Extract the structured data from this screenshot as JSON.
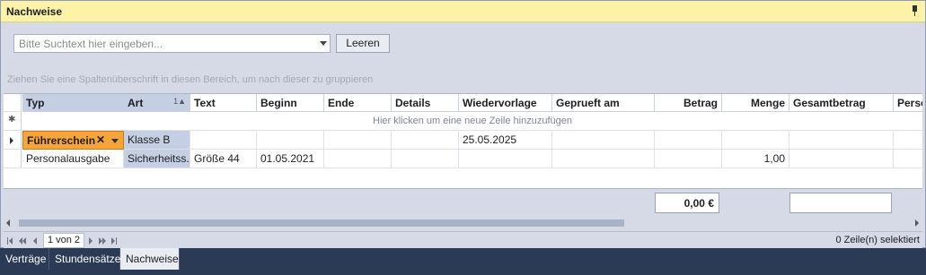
{
  "panel": {
    "title": "Nachweise"
  },
  "search": {
    "placeholder": "Bitte Suchtext hier eingeben...",
    "clear_label": "Leeren"
  },
  "grid": {
    "group_hint": "Ziehen Sie eine Spaltenüberschrift in diesen Bereich, um nach dieser zu gruppieren",
    "columns": [
      "Typ",
      "Art",
      "Text",
      "Beginn",
      "Ende",
      "Details",
      "Wiedervorlage",
      "Geprueft am",
      "Betrag",
      "Menge",
      "Gesamtbetrag",
      "Perso"
    ],
    "sort_indicator": "1▲",
    "new_row_text": "Hier klicken um eine neue Zeile hinzuzufügen",
    "rows": [
      {
        "typ": "Führerschein",
        "art": "Klasse B",
        "text": "",
        "beginn": "",
        "ende": "",
        "details": "",
        "wiedervorlage": "25.05.2025",
        "geprueft": "",
        "betrag": "",
        "menge": "",
        "gesamt": ""
      },
      {
        "typ": "Personalausgabe",
        "art": "Sicherheitss...",
        "text": "Größe 44",
        "beginn": "01.05.2021",
        "ende": "",
        "details": "",
        "wiedervorlage": "",
        "geprueft": "",
        "betrag": "",
        "menge": "1,00",
        "gesamt": ""
      }
    ],
    "total_betrag": "0,00 €",
    "total_gesamt": ""
  },
  "pager": {
    "page_text": "1 von 2",
    "status": "0 Zeile(n) selektiert"
  },
  "tabs": [
    "Verträge",
    "Stundensätze",
    "Nachweise"
  ],
  "colors": {
    "title_bg": "#fdf3a8",
    "group_highlight": "#f7a53b",
    "selected_column": "#c5cfe3"
  }
}
